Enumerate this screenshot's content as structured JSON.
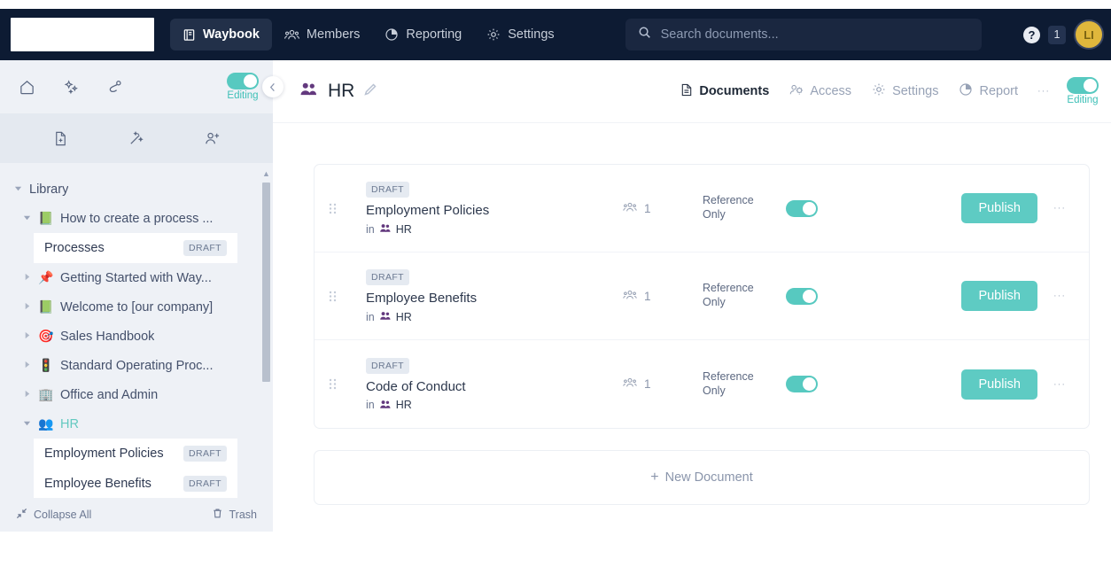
{
  "topnav": {
    "logo_alt": "company-logo",
    "items": [
      {
        "label": "Waybook",
        "icon": "book-icon",
        "active": true
      },
      {
        "label": "Members",
        "icon": "members-icon",
        "active": false
      },
      {
        "label": "Reporting",
        "icon": "reporting-icon",
        "active": false
      },
      {
        "label": "Settings",
        "icon": "gear-icon",
        "active": false
      }
    ],
    "search": {
      "placeholder": "Search documents...",
      "value": ""
    },
    "help_label": "?",
    "notification_count": "1",
    "avatar_initials": "LI"
  },
  "sidebar": {
    "tools_row1": [
      "home-icon",
      "sparkles-icon",
      "share-icon"
    ],
    "editing_label": "Editing",
    "editing_on": true,
    "collapse_icon": "chevron-left-icon",
    "tools_row2": [
      "new-document-icon",
      "magic-wand-icon",
      "add-user-icon"
    ],
    "tree": [
      {
        "label": "Library",
        "level": 0,
        "caret": "down",
        "emoji": ""
      },
      {
        "label": "How to create a process ...",
        "level": 1,
        "caret": "down",
        "emoji": "📗"
      },
      {
        "label": "Processes",
        "level": 2,
        "caret": "none",
        "emoji": "",
        "badge": "DRAFT",
        "card": true
      },
      {
        "label": "Getting Started with Way...",
        "level": 1,
        "caret": "right",
        "emoji": "📌"
      },
      {
        "label": "Welcome to [our company]",
        "level": 1,
        "caret": "right",
        "emoji": "📗"
      },
      {
        "label": "Sales Handbook",
        "level": 1,
        "caret": "right",
        "emoji": "🎯"
      },
      {
        "label": "Standard Operating Proc...",
        "level": 1,
        "caret": "right",
        "emoji": "🚦"
      },
      {
        "label": "Office and Admin",
        "level": 1,
        "caret": "right",
        "emoji": "🏢"
      },
      {
        "label": "HR",
        "level": 1,
        "caret": "down",
        "emoji": "👥",
        "selected": true
      },
      {
        "label": "Employment Policies",
        "level": 2,
        "caret": "none",
        "emoji": "",
        "badge": "DRAFT",
        "card": true
      },
      {
        "label": "Employee Benefits",
        "level": 2,
        "caret": "none",
        "emoji": "",
        "badge": "DRAFT",
        "card": true
      }
    ],
    "footer": {
      "collapse_all": "Collapse All",
      "trash": "Trash"
    }
  },
  "main": {
    "group_icon": "group-icon",
    "title": "HR",
    "edit_icon": "pencil-icon",
    "tabs": [
      {
        "label": "Documents",
        "icon": "document-icon",
        "active": true
      },
      {
        "label": "Access",
        "icon": "access-icon",
        "active": false
      },
      {
        "label": "Settings",
        "icon": "gear-icon",
        "active": false
      },
      {
        "label": "Report",
        "icon": "chart-icon",
        "active": false
      }
    ],
    "tabs_overflow": "···",
    "editing_label": "Editing",
    "editing_on": true,
    "documents": [
      {
        "status": "DRAFT",
        "title": "Employment Policies",
        "in_label": "in",
        "group": "HR",
        "member_count": "1",
        "reference_label": "Reference Only",
        "reference_on": true,
        "publish_label": "Publish",
        "overflow": "···"
      },
      {
        "status": "DRAFT",
        "title": "Employee Benefits",
        "in_label": "in",
        "group": "HR",
        "member_count": "1",
        "reference_label": "Reference Only",
        "reference_on": true,
        "publish_label": "Publish",
        "overflow": "···"
      },
      {
        "status": "DRAFT",
        "title": "Code of Conduct",
        "in_label": "in",
        "group": "HR",
        "member_count": "1",
        "reference_label": "Reference Only",
        "reference_on": true,
        "publish_label": "Publish",
        "overflow": "···"
      }
    ],
    "new_document": {
      "plus": "+",
      "label": "New Document"
    }
  },
  "colors": {
    "navy": "#0d1b33",
    "teal": "#5ecbc3",
    "purple": "#63397e",
    "sidebar_bg": "#eef1f6",
    "avatar_gold": "#e0b73c"
  }
}
